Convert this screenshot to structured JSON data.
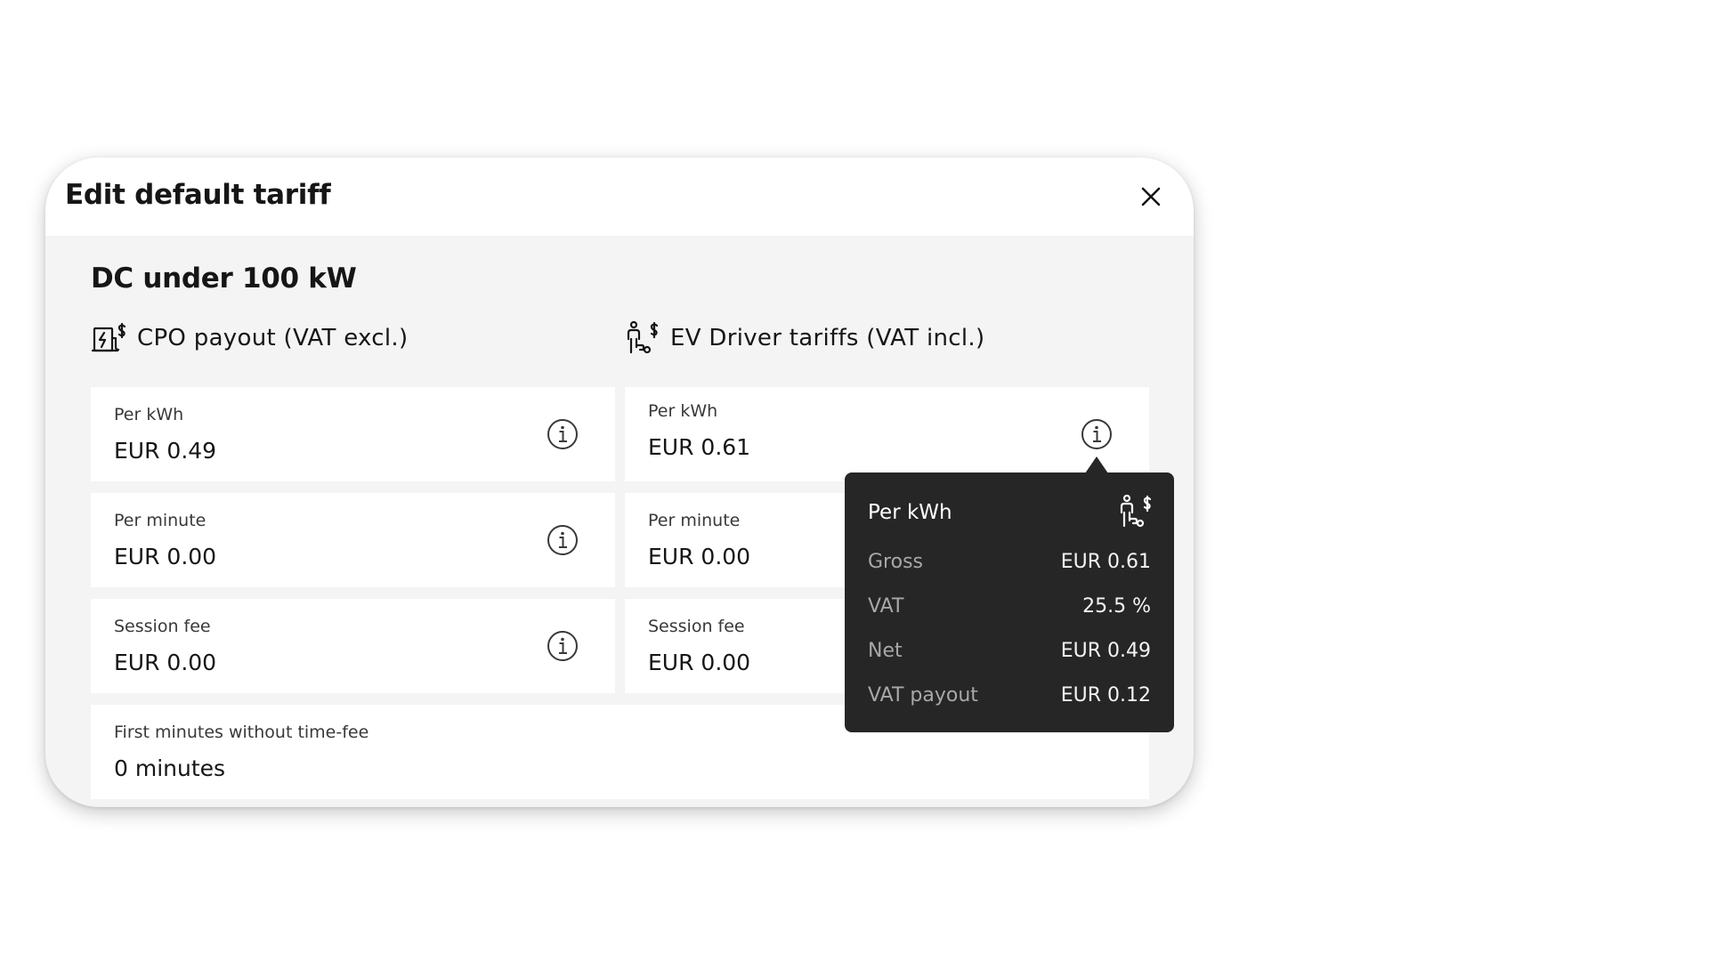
{
  "modal": {
    "title": "Edit default tariff",
    "section_title": "DC under 100 kW"
  },
  "cpo": {
    "header": "CPO payout (VAT excl.)",
    "icon": "charger-payout-icon",
    "fields": [
      {
        "label": "Per kWh",
        "value": "EUR 0.49"
      },
      {
        "label": "Per minute",
        "value": "EUR 0.00"
      },
      {
        "label": "Session fee",
        "value": "EUR 0.00"
      }
    ]
  },
  "driver": {
    "header": "EV Driver tariffs (VAT incl.)",
    "icon": "driver-tariff-icon",
    "fields": [
      {
        "label": "Per kWh",
        "value": "EUR 0.61"
      },
      {
        "label": "Per minute",
        "value": "EUR 0.00"
      },
      {
        "label": "Session fee",
        "value": "EUR 0.00"
      }
    ]
  },
  "free_minutes": {
    "label": "First minutes without time-fee",
    "value": "0 minutes"
  },
  "tooltip": {
    "title": "Per kWh",
    "rows": [
      {
        "key": "Gross",
        "value": "EUR 0.61"
      },
      {
        "key": "VAT",
        "value": "25.5 %"
      },
      {
        "key": "Net",
        "value": "EUR 0.49"
      },
      {
        "key": "VAT payout",
        "value": "EUR 0.12"
      }
    ]
  },
  "colors": {
    "modal_bg": "#f4f4f4",
    "field_bg": "#ffffff",
    "tooltip_bg": "#262626",
    "text": "#161616"
  }
}
